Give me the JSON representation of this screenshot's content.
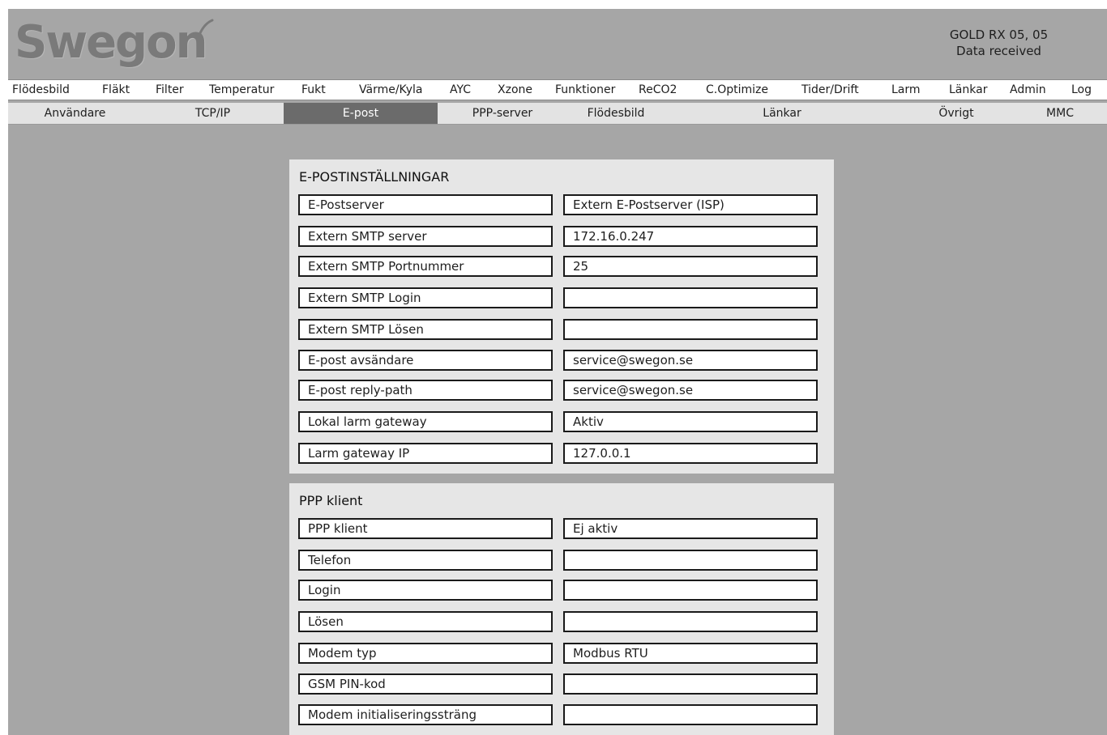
{
  "header": {
    "logo_text": "Swegon",
    "device_line1": "GOLD RX 05, 05",
    "device_line2": "Data received"
  },
  "main_nav": [
    "Flödesbild",
    "Fläkt",
    "Filter",
    "Temperatur",
    "Fukt",
    "Värme/Kyla",
    "AYC",
    "Xzone",
    "Funktioner",
    "ReCO2",
    "C.Optimize",
    "Tider/Drift",
    "Larm",
    "Länkar",
    "Admin",
    "Log"
  ],
  "sub_nav": {
    "items": [
      "Användare",
      "TCP/IP",
      "E-post",
      "PPP-server",
      "Flödesbild",
      "Länkar",
      "Övrigt",
      "MMC"
    ],
    "active": "E-post"
  },
  "email_panel": {
    "title": "E-POSTINSTÄLLNINGAR",
    "rows": [
      {
        "label": "E-Postserver",
        "value": "Extern E-Postserver (ISP)"
      },
      {
        "label": "Extern SMTP server",
        "value": "172.16.0.247"
      },
      {
        "label": "Extern SMTP Portnummer",
        "value": "25"
      },
      {
        "label": "Extern SMTP Login",
        "value": ""
      },
      {
        "label": "Extern SMTP Lösen",
        "value": ""
      },
      {
        "label": "E-post avsändare",
        "value": "service@swegon.se"
      },
      {
        "label": "E-post reply-path",
        "value": "service@swegon.se"
      },
      {
        "label": "Lokal larm gateway",
        "value": "Aktiv"
      },
      {
        "label": "Larm gateway IP",
        "value": "127.0.0.1"
      }
    ]
  },
  "ppp_panel": {
    "title": "PPP klient",
    "rows": [
      {
        "label": "PPP klient",
        "value": "Ej aktiv"
      },
      {
        "label": "Telefon",
        "value": ""
      },
      {
        "label": "Login",
        "value": ""
      },
      {
        "label": "Lösen",
        "value": ""
      },
      {
        "label": "Modem typ",
        "value": "Modbus RTU"
      },
      {
        "label": "GSM PIN-kod",
        "value": ""
      },
      {
        "label": "Modem initialiseringssträng",
        "value": ""
      }
    ]
  }
}
